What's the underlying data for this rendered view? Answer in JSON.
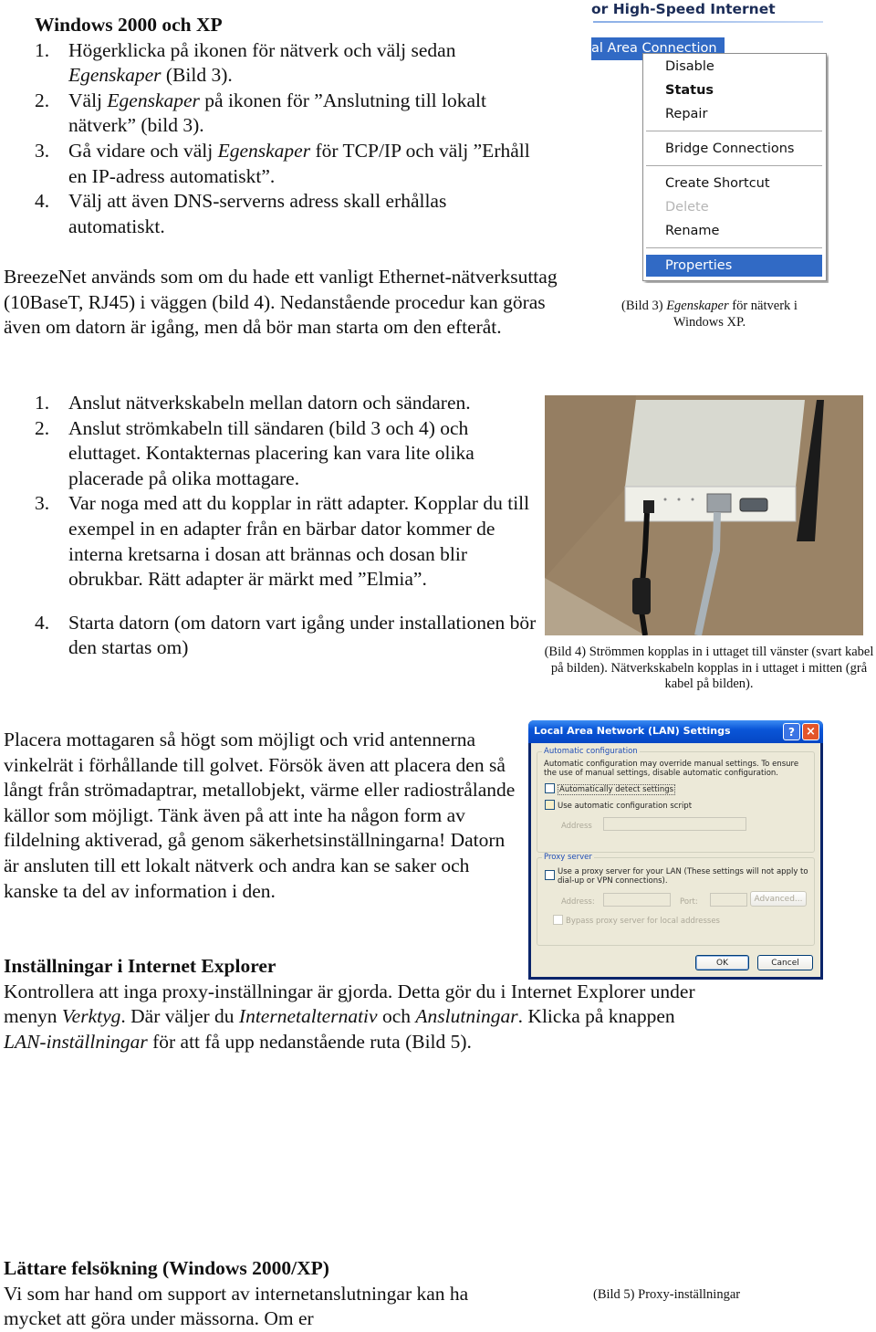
{
  "section1": {
    "heading": "Windows 2000 och XP",
    "steps": [
      {
        "num": "1.",
        "parts": [
          {
            "t": "Högerklicka på ikonen för nätverk och välj sedan "
          },
          {
            "t": "Egenskaper",
            "i": true
          },
          {
            "t": "  (Bild 3)."
          }
        ]
      },
      {
        "num": "2.",
        "parts": [
          {
            "t": "Välj "
          },
          {
            "t": "Egenskaper",
            "i": true
          },
          {
            "t": " på ikonen för ”Anslutning till lokalt nätverk” (bild 3)."
          }
        ]
      },
      {
        "num": "3.",
        "parts": [
          {
            "t": "Gå vidare och välj "
          },
          {
            "t": "Egenskaper",
            "i": true
          },
          {
            "t": " för TCP/IP och välj ”Erhåll en IP-adress automatiskt”."
          }
        ]
      },
      {
        "num": "4.",
        "parts": [
          {
            "t": "Välj att även DNS-serverns adress skall erhållas automatiskt."
          }
        ]
      }
    ]
  },
  "intro_paragraph": "BreezeNet används som om du hade ett vanligt Ethernet-nätverksuttag (10BaseT, RJ45) i väggen (bild 4). Nedanstående procedur kan göras även om datorn är igång, men då bör man starta om den efteråt.",
  "figure3": {
    "header_text": "or High-Speed Internet",
    "connection_label": "al Area Connection",
    "menu_items": [
      {
        "label": "Disable",
        "style": "normal"
      },
      {
        "label": "Status",
        "style": "bold"
      },
      {
        "label": "Repair",
        "style": "normal"
      },
      {
        "label": "Bridge Connections",
        "style": "normal"
      },
      {
        "label": "Create Shortcut",
        "style": "normal"
      },
      {
        "label": "Delete",
        "style": "disabled"
      },
      {
        "label": "Rename",
        "style": "normal"
      },
      {
        "label": "Properties",
        "style": "selected"
      }
    ],
    "caption_prefix": "(Bild 3) ",
    "caption_italic": "Egenskaper",
    "caption_suffix": " för nätverk i Windows XP."
  },
  "section2": {
    "steps": [
      {
        "num": "1.",
        "text": "Anslut nätverkskabeln mellan datorn och sändaren."
      },
      {
        "num": "2.",
        "text": "Anslut strömkabeln till sändaren (bild 3 och 4) och eluttaget. Kontakternas placering kan vara lite olika placerade på olika mottagare."
      },
      {
        "num": "3.",
        "text": "Var noga med att du kopplar in rätt adapter. Kopplar du till exempel in en adapter från en bärbar dator kommer de interna kretsarna i dosan att brännas och dosan blir obrukbar. Rätt adapter är märkt med ”Elmia”."
      },
      {
        "num": "4.",
        "text": "Starta datorn (om datorn vart igång under installationen bör den startas om)"
      }
    ]
  },
  "figure4": {
    "image_desc": "Photo of BreezeNet receiver box with antenna, black power cable and grey network cable",
    "caption": "(Bild 4) Strömmen kopplas in i uttaget till vänster (svart kabel på bilden). Nätverkskabeln kopplas in i uttaget i mitten (grå kabel på bilden)."
  },
  "placement_paragraph": "Placera mottagaren så högt som möjligt och vrid antennerna vinkelrät i förhållande till golvet. Försök även att placera den så långt från strömadaptrar, metallobjekt, värme eller radiostrålande källor som möjligt. Tänk även på att inte ha någon form av fildelning aktiverad, gå genom säkerhetsinställningarna! Datorn är ansluten till ett lokalt nätverk och andra kan se saker och kanske ta del av information i den.",
  "section3": {
    "heading": "Inställningar i Internet Explorer",
    "parts": [
      {
        "t": "Kontrollera att inga proxy-inställningar är gjorda. Detta gör du i Internet Explorer under menyn "
      },
      {
        "t": "Verktyg",
        "i": true
      },
      {
        "t": ". Där väljer du "
      },
      {
        "t": "Internetalternativ",
        "i": true
      },
      {
        "t": " och "
      },
      {
        "t": "Anslutningar",
        "i": true
      },
      {
        "t": ". Klicka på knappen "
      },
      {
        "t": "LAN-inställningar",
        "i": true
      },
      {
        "t": " för att få upp nedanstående ruta (Bild 5)."
      }
    ]
  },
  "figure5": {
    "dialog_title": "Local Area Network (LAN) Settings",
    "help_icon": "?",
    "close_icon": "×",
    "auto_config_legend": "Automatic configuration",
    "auto_config_desc": "Automatic configuration may override manual settings.  To ensure the use of manual settings, disable automatic configuration.",
    "auto_detect_label": "Automatically detect settings",
    "auto_detect_checked": false,
    "auto_script_label": "Use automatic configuration script",
    "auto_script_checked": false,
    "address_label": "Address",
    "address_value": "",
    "proxy_legend": "Proxy server",
    "use_proxy_label": "Use a proxy server for your LAN (These settings will not apply to dial-up or VPN connections).",
    "use_proxy_checked": false,
    "proxy_address_label": "Address:",
    "proxy_address_value": "",
    "port_label": "Port:",
    "port_value": "",
    "advanced_label": "Advanced...",
    "bypass_label": "Bypass proxy server for local addresses",
    "bypass_checked": false,
    "ok_label": "OK",
    "cancel_label": "Cancel",
    "caption": "(Bild 5) Proxy-inställningar"
  },
  "section4": {
    "heading": "Lättare felsökning (Windows 2000/XP)",
    "text": "Vi som har hand om support av internetanslutningar kan ha mycket att göra under mässorna. Om er"
  }
}
